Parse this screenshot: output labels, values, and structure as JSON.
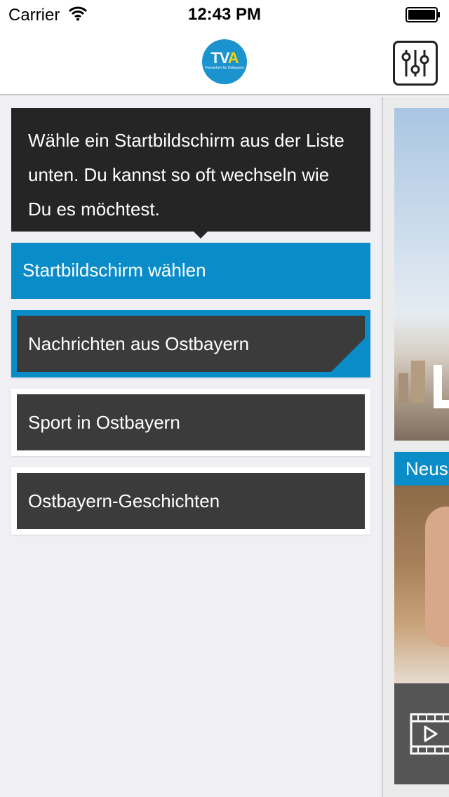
{
  "status_bar": {
    "carrier": "Carrier",
    "time": "12:43 PM"
  },
  "nav": {
    "logo_text": "TV",
    "logo_accent": "A",
    "logo_subtitle": "Fernsehen für Ostbayern"
  },
  "menu": {
    "tooltip": "Wähle ein Startbildschirm aus der Liste unten. Du kannst so oft wechseln wie Du es möchtest.",
    "section_header": "Startbildschirm wählen",
    "items": [
      {
        "label": "Nachrichten aus Ostbayern",
        "selected": true
      },
      {
        "label": "Sport in Ostbayern",
        "selected": false
      },
      {
        "label": "Ostbayern-Geschichten",
        "selected": false
      }
    ]
  },
  "content": {
    "news_header": "Neus"
  },
  "colors": {
    "accent": "#0a8cc8",
    "dark_tile": "#3b3b3b",
    "tooltip_bg": "#252525",
    "background": "#efeff4"
  }
}
